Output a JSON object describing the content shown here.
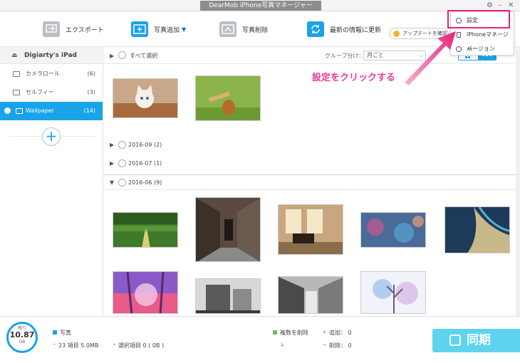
{
  "app": {
    "title": "DearMob iPhone写真マネージャー"
  },
  "toolbar": {
    "export_label": "エクスポート",
    "add_label": "写真追加",
    "delete_label": "写真削除",
    "refresh_label": "最新の情報に更新",
    "update_label": "アップデートを確認"
  },
  "settings_menu": {
    "items": [
      {
        "label": "設定",
        "icon": "gear-icon"
      },
      {
        "label": "iPhoneマネージャー",
        "icon": "phone-icon"
      },
      {
        "label": "バージョン",
        "icon": "info-icon"
      }
    ]
  },
  "annotation": {
    "text": "設定をクリックする",
    "color": "#e93c94"
  },
  "sidebar": {
    "device_name": "Digiarty's iPad",
    "items": [
      {
        "label": "カメラロール",
        "count": "(6)"
      },
      {
        "label": "セルフィー",
        "count": "(3)"
      },
      {
        "label": "Wallpaper",
        "count": "(14)",
        "active": true
      }
    ]
  },
  "content": {
    "select_all_label": "すべて選択",
    "group_label": "グループ分け：",
    "group_value": "月ごと",
    "sections": [
      {
        "label": "2016-09 (2)"
      },
      {
        "label": "2016-07 (1)"
      },
      {
        "label": "2016-06 (9)",
        "open": true
      }
    ]
  },
  "footer": {
    "storage": {
      "label": "残り",
      "value": "10.87",
      "unit": "GB"
    },
    "category_label": "写真",
    "summary_text": "23 項目 5.0MB",
    "selected_text": "選択項目 0 ( 0B )",
    "delete_label": "複数を削除",
    "add_count_text": "追加： 0",
    "remove_count_text": "削除： 0",
    "sync_label": "同期"
  },
  "colors": {
    "accent": "#1aa3e8",
    "highlight": "#e6237c",
    "sync": "#5ed3ef"
  }
}
